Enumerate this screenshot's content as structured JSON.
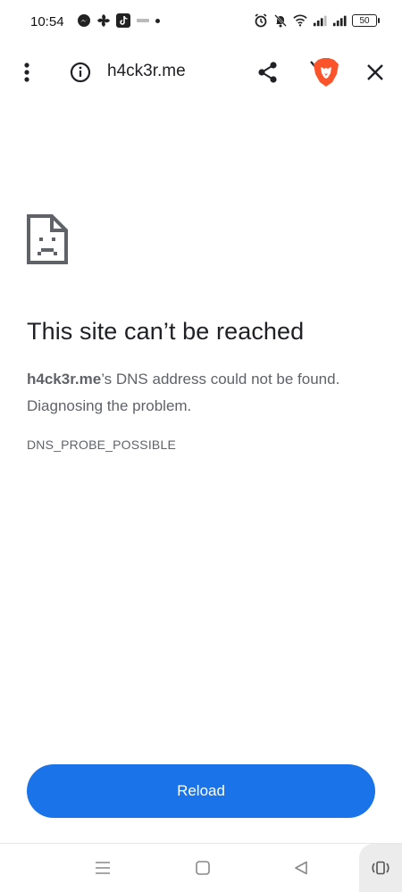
{
  "status_bar": {
    "time": "10:54",
    "battery_level": "50"
  },
  "toolbar": {
    "url": "h4ck3r.me"
  },
  "error": {
    "title": "This site can’t be reached",
    "domain": "h4ck3r.me",
    "description_rest": "’s DNS address could not be found. Diagnosing the problem.",
    "code": "DNS_PROBE_POSSIBLE"
  },
  "actions": {
    "reload_label": "Reload"
  },
  "colors": {
    "accent": "#1a73e8",
    "brave": "#fb542b"
  },
  "icons": {
    "menu": "more-vert-icon",
    "info": "info-icon",
    "share": "share-icon",
    "brave": "brave-lion-icon",
    "close": "close-icon",
    "sad_page": "sad-page-icon"
  }
}
